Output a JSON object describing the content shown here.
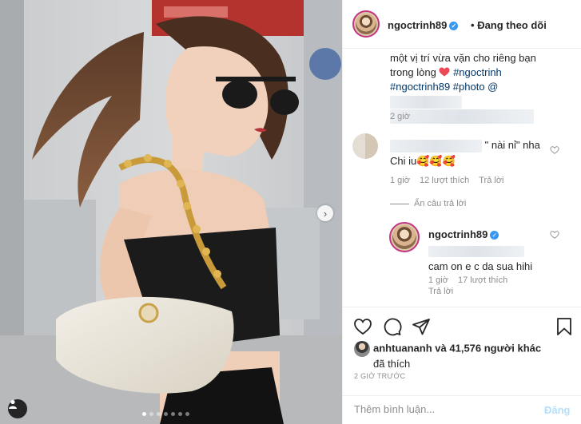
{
  "header": {
    "username": "ngoctrinh89",
    "follow_status": "• Đang theo dõi",
    "follow_dot": "•",
    "follow_text": "Đang theo dõi"
  },
  "caption": {
    "line1": "một vị trí vừa vặn cho riêng bạn",
    "line2_pre": "trong lòng",
    "hashtag1": "#ngoctrinh",
    "hashtag2": "#ngoctrinh89",
    "hashtag3": "#photo @",
    "time": "2 giờ"
  },
  "comment1": {
    "quote": "\" nài nỉ\" nha",
    "text": "Chi iu",
    "emojis": "🥰🥰🥰",
    "time": "1 giờ",
    "likes": "12 lượt thích",
    "reply": "Trả lời",
    "hide_replies": "Ẩn câu trả lời"
  },
  "reply1": {
    "username": "ngoctrinh89",
    "text": "cam on e c da sua hihi",
    "time": "1 giờ",
    "likes": "17 lượt thích",
    "reply": "Trả lời"
  },
  "likes": {
    "user": "anhtuananh",
    "rest": "và 41,576 người khác",
    "line2": "đã thích"
  },
  "post_time": "2 GIỜ TRƯỚC",
  "add_comment": {
    "placeholder": "Thêm bình luận...",
    "post_label": "Đăng"
  },
  "carousel": {
    "count": 7,
    "active": 0
  },
  "colors": {
    "accent_blue": "#3897f0",
    "hashtag": "#00376b",
    "heart_red": "#ed4956",
    "post_disabled": "#b2dffc"
  }
}
